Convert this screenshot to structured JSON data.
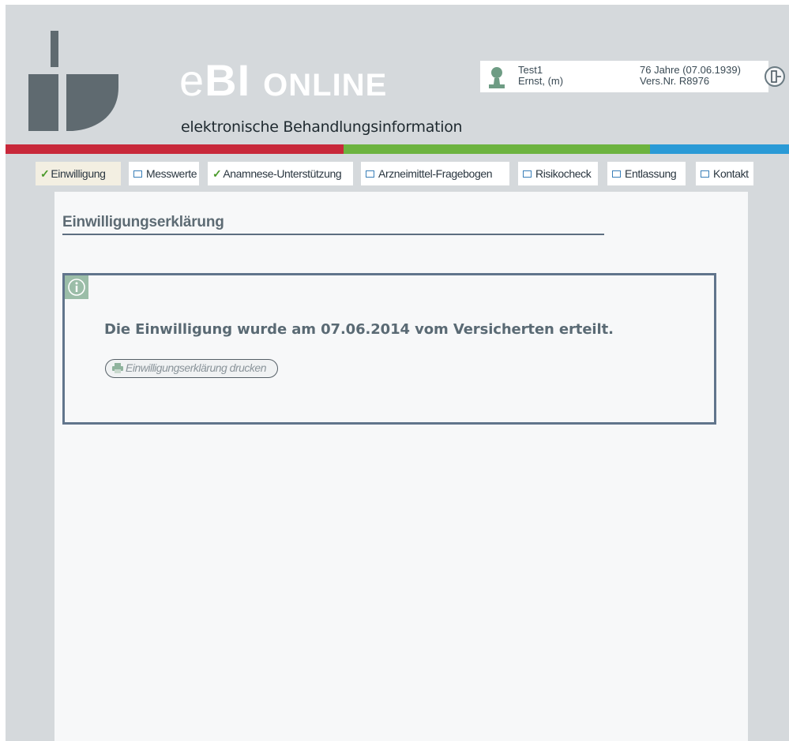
{
  "header": {
    "brand_e": "e",
    "brand_bi": "BI",
    "brand_online": "ONLINE",
    "subtitle": "elektronische Behandlungsinformation"
  },
  "patient": {
    "line1": "Test1",
    "line2": "Ernst, (m)",
    "age": "76 Jahre (07.06.1939)",
    "insurance": "Vers.Nr. R8976"
  },
  "tabs": [
    {
      "label": "Einwilligung",
      "state": "checked"
    },
    {
      "label": "Messwerte",
      "state": "open"
    },
    {
      "label": "Anamnese-Unterstützung",
      "state": "checked"
    },
    {
      "label": "Arzneimittel-Fragebogen",
      "state": "open"
    },
    {
      "label": "Risikocheck",
      "state": "open"
    },
    {
      "label": "Entlassung",
      "state": "open"
    },
    {
      "label": "Kontakt",
      "state": "open"
    }
  ],
  "main": {
    "title": "Einwilligungserklärung",
    "info_message": "Die Einwilligung wurde am 07.06.2014 vom Versicherten erteilt.",
    "print_button": "Einwilligungserklärung drucken"
  },
  "colors": {
    "stripe_red": "#c8283a",
    "stripe_green": "#6cb33f",
    "stripe_blue": "#2a9ad6",
    "check_green": "#4a9a2a",
    "info_icon_bg": "#9bbda8"
  }
}
